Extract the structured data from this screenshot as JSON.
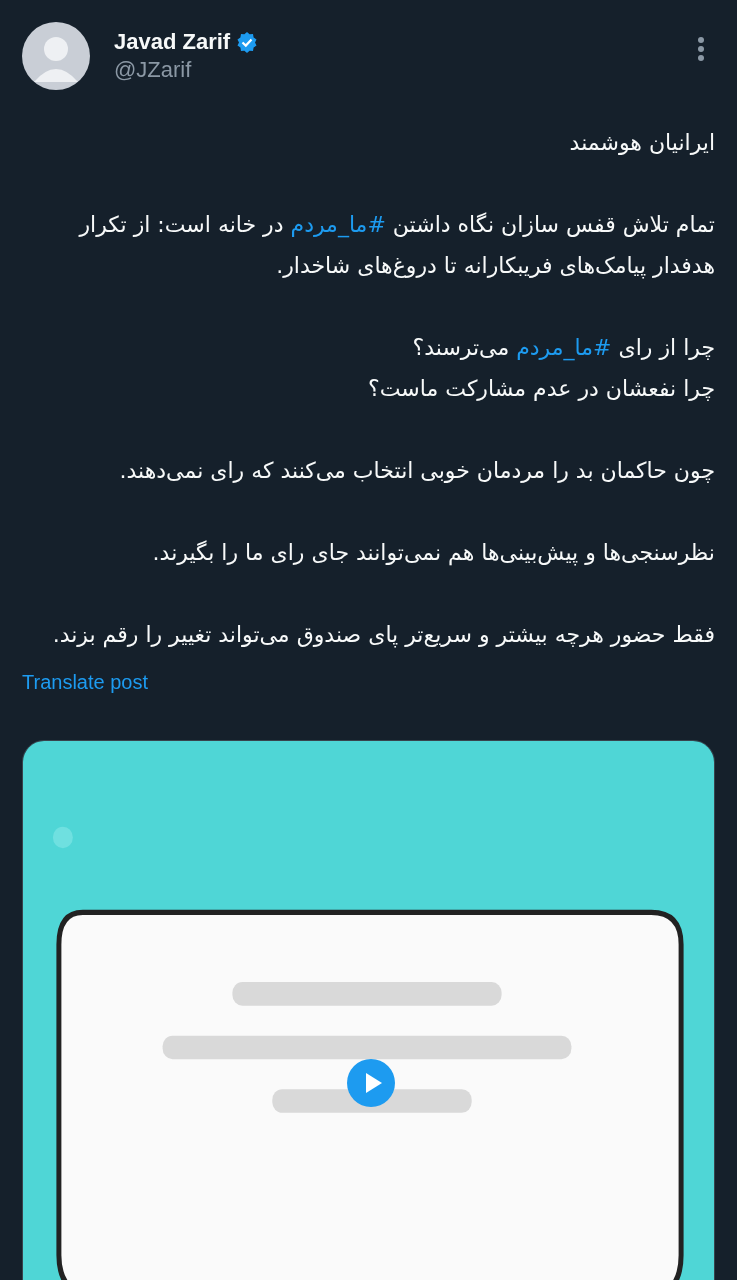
{
  "author": {
    "name": "Javad Zarif",
    "verified": true,
    "handle": "@JZarif"
  },
  "paragraphs": [
    {
      "lines": [
        [
          {
            "kind": "text",
            "text": "ایرانیان هوشمند"
          }
        ]
      ]
    },
    {
      "lines": [
        [
          {
            "kind": "text",
            "text": "تمام تلاش قفس سازان نگاه داشتن "
          },
          {
            "kind": "hashtag",
            "text": "#ما_مردم"
          },
          {
            "kind": "text",
            "text": " در خانه است:  از تکرار هدفدار پیامک‌های فریبکارانه تا دروغ‌های شاخدار."
          }
        ]
      ]
    },
    {
      "lines": [
        [
          {
            "kind": "text",
            "text": "چرا از رای "
          },
          {
            "kind": "hashtag",
            "text": "#ما_مردم"
          },
          {
            "kind": "text",
            "text": " می‌ترسند؟"
          }
        ],
        [
          {
            "kind": "text",
            "text": "چرا نفعشان در عدم مشارکت ماست؟"
          }
        ]
      ]
    },
    {
      "lines": [
        [
          {
            "kind": "text",
            "text": "چون حاکمان بد را مردمان خوبی انتخاب می‌کنند که رای نمی‌دهند."
          }
        ]
      ]
    },
    {
      "lines": [
        [
          {
            "kind": "text",
            "text": "نظرسنجی‌ها و پیش‌بینی‌ها هم نمی‌توانند جای رای ما را بگیرند."
          }
        ]
      ]
    },
    {
      "lines": [
        [
          {
            "kind": "text",
            "text": "فقط حضور هرچه بیشتر و سریع‌تر پای صندوق می‌تواند تغییر را رقم بزند."
          }
        ]
      ]
    }
  ],
  "translate_link": "Translate post",
  "media": {
    "kind": "video"
  }
}
